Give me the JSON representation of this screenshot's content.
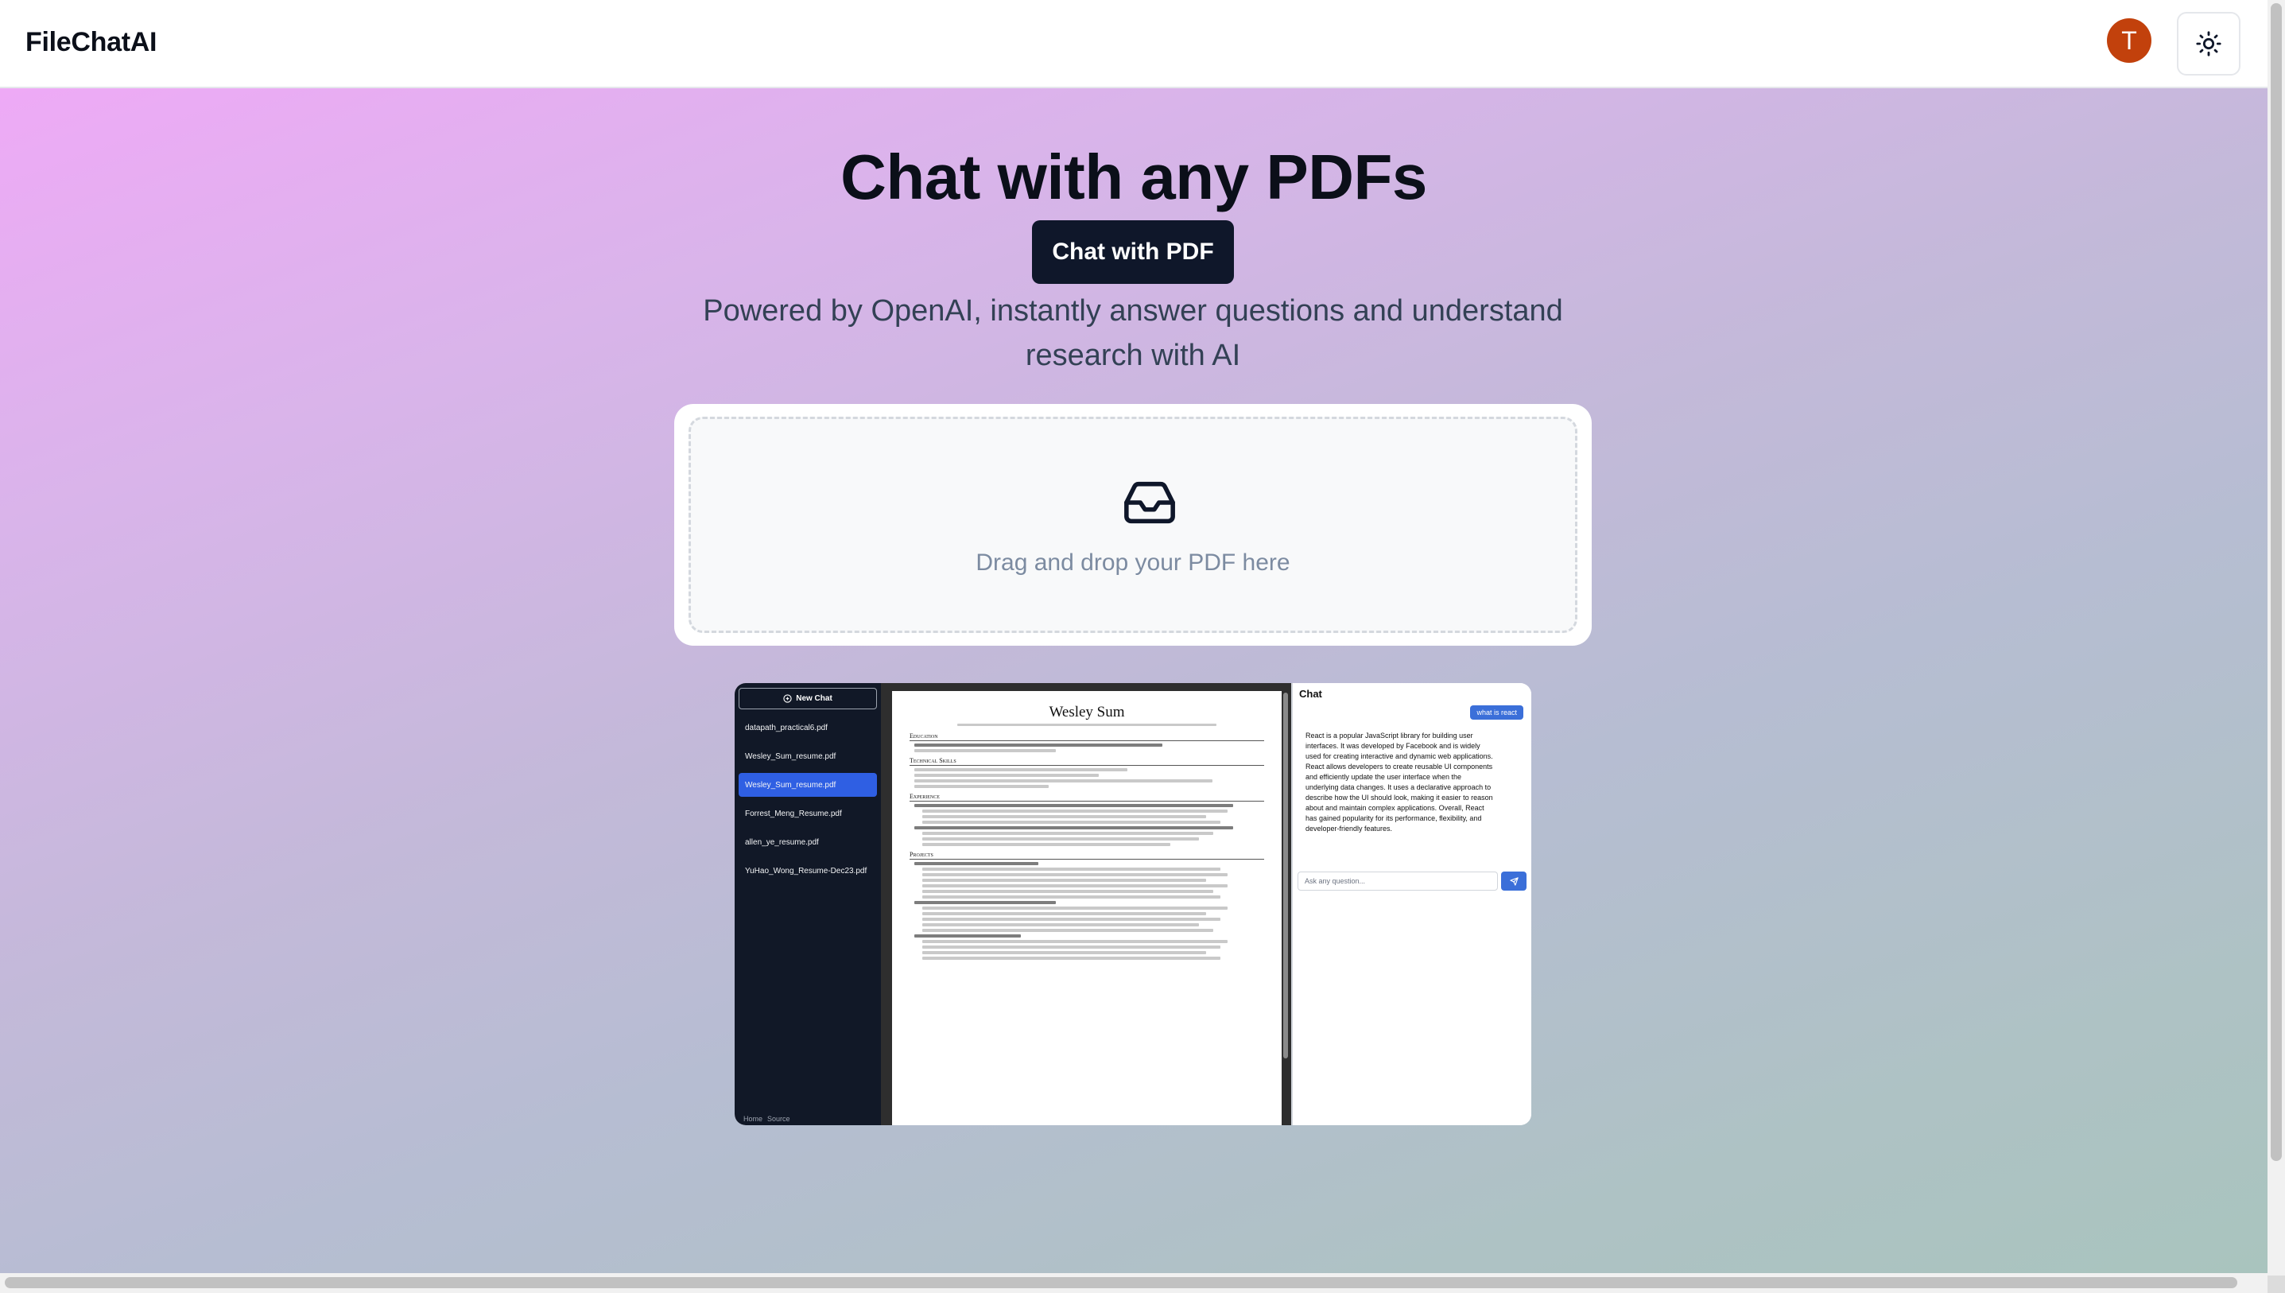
{
  "header": {
    "brand": "FileChatAI",
    "avatar_initial": "T",
    "theme_toggle_icon": "sun-icon"
  },
  "hero": {
    "title": "Chat with any PDFs",
    "cta_label": "Chat with PDF",
    "subtitle": "Powered by OpenAI, instantly answer questions and understand research with AI"
  },
  "dropzone": {
    "icon": "inbox-icon",
    "text": "Drag and drop your PDF here"
  },
  "preview": {
    "sidebar": {
      "new_chat_label": "New Chat",
      "files": [
        {
          "name": "datapath_practical6.pdf",
          "active": false
        },
        {
          "name": "Wesley_Sum_resume.pdf",
          "active": false
        },
        {
          "name": "Wesley_Sum_resume.pdf",
          "active": true
        },
        {
          "name": "Forrest_Meng_Resume.pdf",
          "active": false
        },
        {
          "name": "allen_ye_resume.pdf",
          "active": false
        },
        {
          "name": "YuHao_Wong_Resume-Dec23.pdf",
          "active": false
        }
      ],
      "footer_links": [
        "Home",
        "Source"
      ]
    },
    "document": {
      "name": "Wesley Sum",
      "sections": [
        "Education",
        "Technical Skills",
        "Experience",
        "Projects"
      ]
    },
    "chat": {
      "title": "Chat",
      "user_message": "what is react",
      "bot_message": "React is a popular JavaScript library for building user interfaces. It was developed by Facebook and is widely used for creating interactive and dynamic web applications. React allows developers to create reusable UI components and efficiently update the user interface when the underlying data changes. It uses a declarative approach to describe how the UI should look, making it easier to reason about and maintain complex applications. Overall, React has gained popularity for its performance, flexibility, and developer-friendly features.",
      "input_placeholder": "Ask any question..."
    }
  },
  "colors": {
    "accent": "#0f172a",
    "avatar": "#c2410c",
    "active_file": "#2f5fe3",
    "chat_accent": "#3b6fd9"
  }
}
